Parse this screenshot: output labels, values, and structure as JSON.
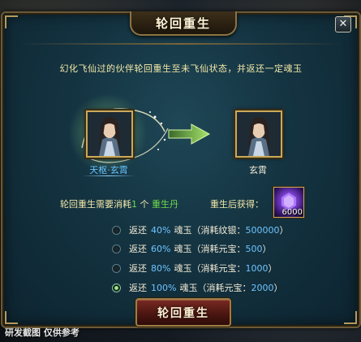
{
  "dialog": {
    "title": "轮回重生",
    "close_label": "✕",
    "description": "幻化飞仙过的伙伴轮回重生至未飞仙状态，并返还一定魂玉"
  },
  "characters": {
    "before_name": "天枢·玄霄",
    "after_name": "玄霄"
  },
  "cost": {
    "prefix": "轮回重生需要消耗",
    "count": "1",
    "unit": "个",
    "item": "重生丹"
  },
  "reward": {
    "label": "重生后获得：",
    "item_icon": "purple-soul-jade-icon",
    "count": "6000"
  },
  "options": [
    {
      "prefix": "返还",
      "percent": "40%",
      "item": "魂玉",
      "detail_open": "（消耗纹银：",
      "amount": "500000",
      "detail_close": "）",
      "checked": false
    },
    {
      "prefix": "返还",
      "percent": "60%",
      "item": "魂玉",
      "detail_open": "（消耗元宝：",
      "amount": "500",
      "detail_close": "）",
      "checked": false
    },
    {
      "prefix": "返还",
      "percent": "80%",
      "item": "魂玉",
      "detail_open": "（消耗元宝：",
      "amount": "1000",
      "detail_close": "）",
      "checked": false
    },
    {
      "prefix": "返还",
      "percent": "100%",
      "item": "魂玉",
      "detail_open": "（消耗元宝：",
      "amount": "2000",
      "detail_close": "）",
      "checked": true
    }
  ],
  "confirm_button": "轮回重生",
  "watermark": "研发截图 仅供参考",
  "colors": {
    "accent_gold": "#c9a95a",
    "text_yellow": "#f3e9a8",
    "text_green": "#6fdc4a",
    "text_blue": "#6fc4ff",
    "button_red": "#7a2a22"
  }
}
